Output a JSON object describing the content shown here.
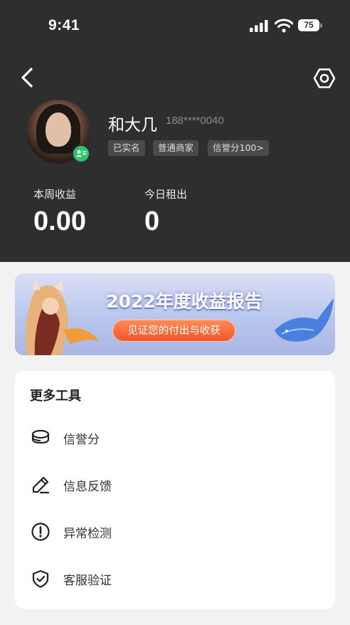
{
  "status_bar": {
    "time": "9:41",
    "battery": "75"
  },
  "profile": {
    "name": "和大几",
    "phone": "188****0040",
    "tags": [
      "已实名",
      "普通商家",
      "信誉分100>"
    ]
  },
  "stats": [
    {
      "label": "本周收益",
      "value": "0.00"
    },
    {
      "label": "今日租出",
      "value": "0"
    }
  ],
  "banner": {
    "title": "2022年度收益报告",
    "cta": "见证您的付出与收获"
  },
  "tools": {
    "title": "更多工具",
    "items": [
      {
        "label": "信誉分",
        "icon": "coin-stack-icon"
      },
      {
        "label": "信息反馈",
        "icon": "pencil-icon"
      },
      {
        "label": "异常检测",
        "icon": "alert-circle-icon"
      },
      {
        "label": "客服验证",
        "icon": "shield-check-icon"
      }
    ]
  },
  "colors": {
    "header_bg": "#2e2e2e",
    "verified_badge": "#2ec46a",
    "cta_orange": "#f2552c"
  }
}
